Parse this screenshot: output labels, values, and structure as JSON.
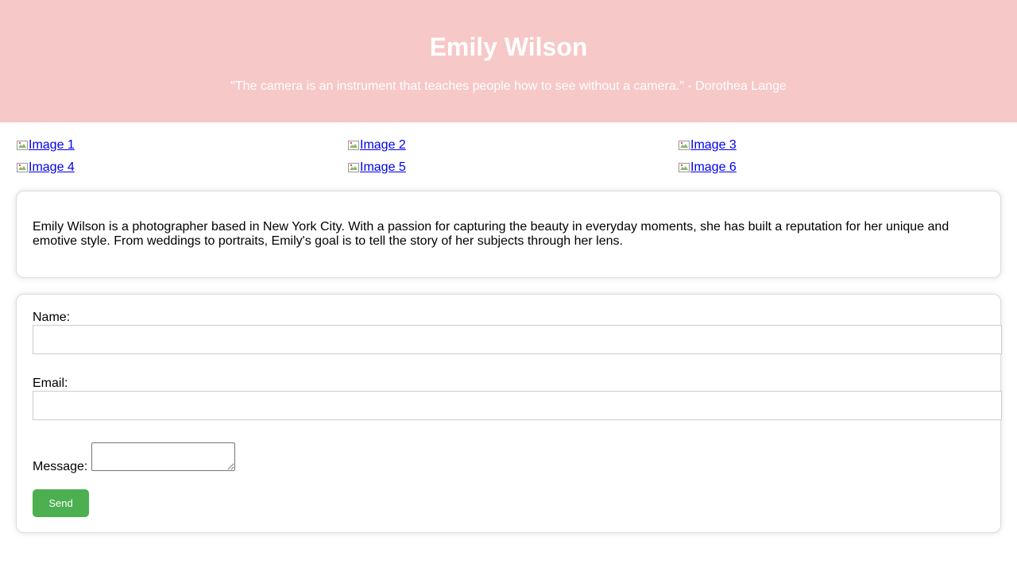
{
  "header": {
    "name": "Emily Wilson",
    "quote": "\"The camera is an instrument that teaches people how to see without a camera.\" - Dorothea Lange",
    "background": "#f7c8c8"
  },
  "gallery": {
    "images": [
      {
        "alt": "Image 1"
      },
      {
        "alt": "Image 2"
      },
      {
        "alt": "Image 3"
      },
      {
        "alt": "Image 4"
      },
      {
        "alt": "Image 5"
      },
      {
        "alt": "Image 6"
      }
    ],
    "link_color": "#0000ee"
  },
  "about": {
    "text": "Emily Wilson is a photographer based in New York City. With a passion for capturing the beauty in everyday moments, she has built a reputation for her unique and emotive style. From weddings to portraits, Emily's goal is to tell the story of her subjects through her lens."
  },
  "contact": {
    "name_label": "Name:",
    "name_value": "",
    "email_label": "Email:",
    "email_value": "",
    "message_label": "Message:",
    "message_value": "",
    "send_label": "Send",
    "button_color": "#4caf50"
  },
  "icons": {
    "broken_image": "broken-image-icon"
  }
}
